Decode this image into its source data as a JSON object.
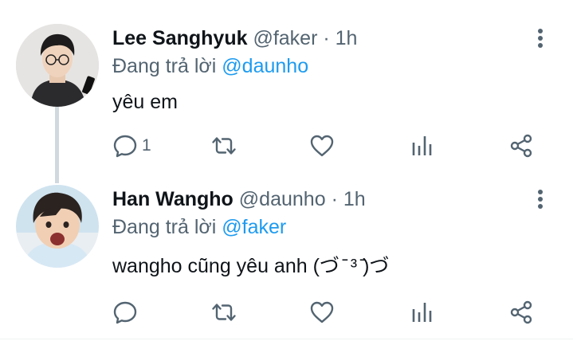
{
  "tweets": [
    {
      "name": "Lee Sanghyuk",
      "handle": "@faker",
      "separator": "·",
      "time": "1h",
      "reply_prefix": "Đang trả lời",
      "reply_to": "@daunho",
      "text": "yêu em",
      "reply_count": "1",
      "avatar": "avatar-faker"
    },
    {
      "name": "Han Wangho",
      "handle": "@daunho",
      "separator": "·",
      "time": "1h",
      "reply_prefix": "Đang trả lời",
      "reply_to": "@faker",
      "text": "wangho cũng yêu anh (づ ̄ ³ ̄)づ",
      "reply_count": "",
      "avatar": "avatar-daunho"
    }
  ],
  "colors": {
    "link": "#1d9bf0",
    "secondary": "#536471",
    "thread_line": "#cfd9de"
  },
  "icons": [
    "more-vertical-icon",
    "reply-icon",
    "retweet-icon",
    "like-icon",
    "stats-icon",
    "share-icon"
  ]
}
